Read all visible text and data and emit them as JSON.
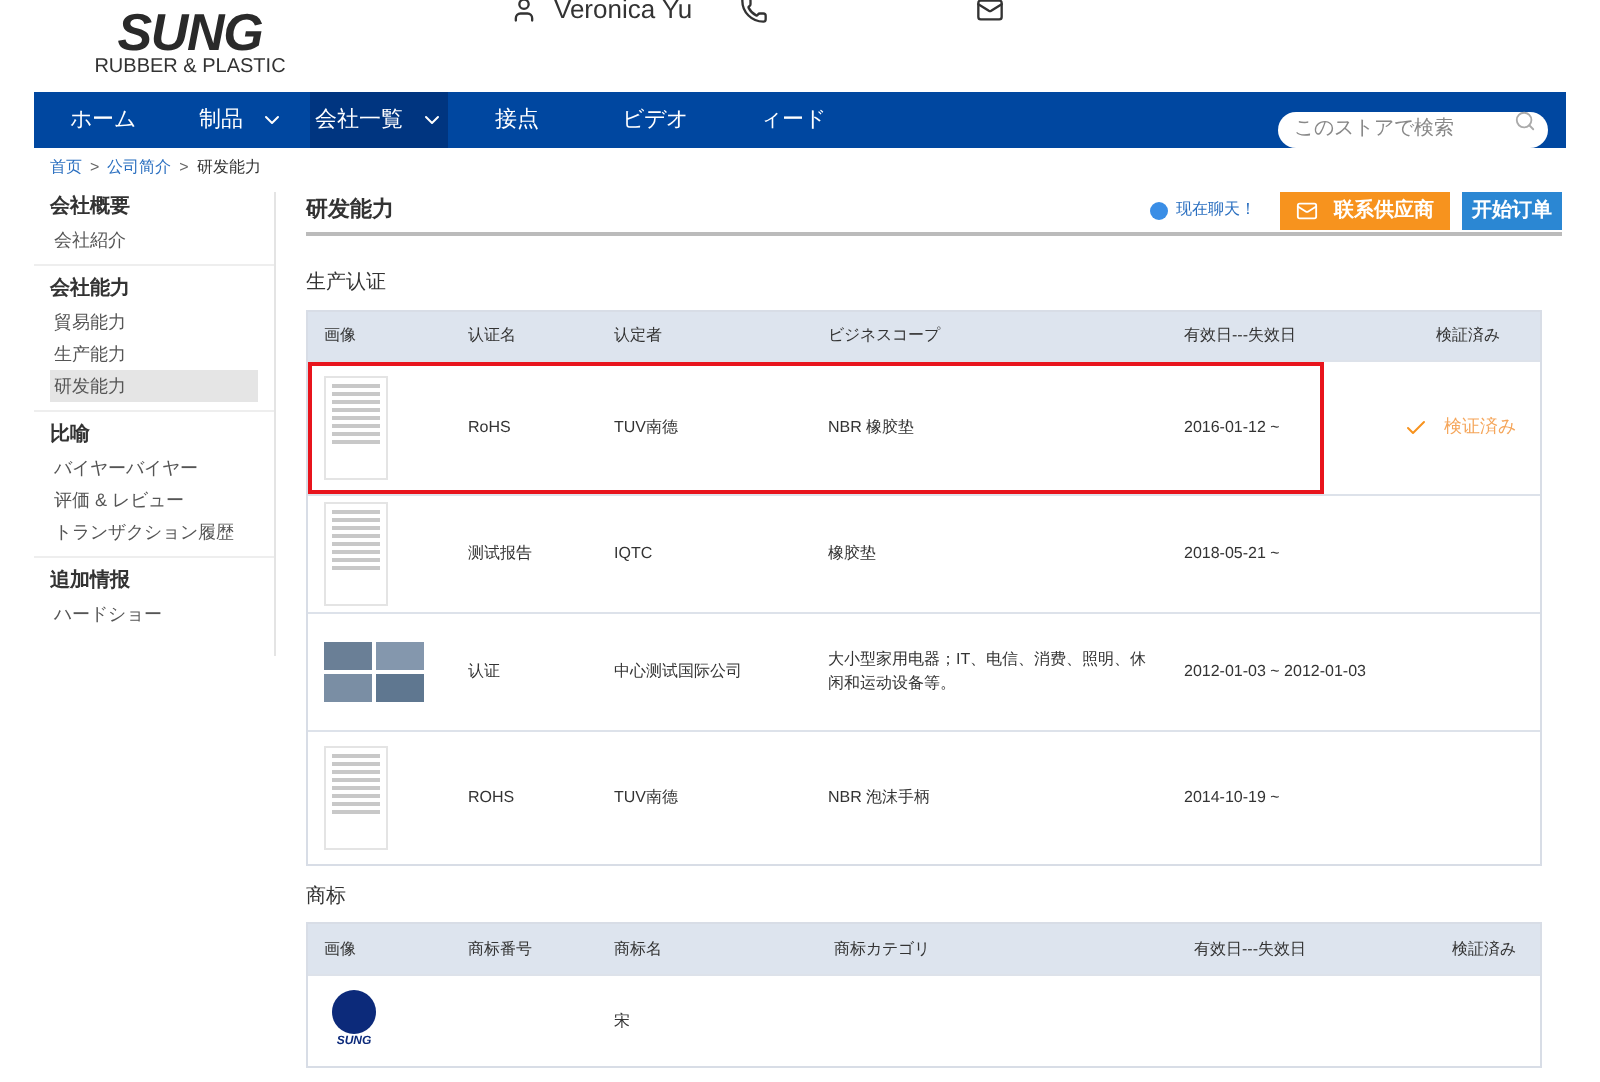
{
  "header": {
    "logo": {
      "name": "SUNG",
      "tagline": "RUBBER & PLASTIC"
    },
    "contact": {
      "name": "Veronica Yu"
    }
  },
  "nav": {
    "items": [
      {
        "label": "ホーム",
        "dropdown": false,
        "selected": false
      },
      {
        "label": "制品",
        "dropdown": true,
        "selected": false
      },
      {
        "label": "会社一覧",
        "dropdown": true,
        "selected": true
      },
      {
        "label": "接点",
        "dropdown": false,
        "selected": false
      },
      {
        "label": "ビデオ",
        "dropdown": false,
        "selected": false
      },
      {
        "label": "ィード",
        "dropdown": false,
        "selected": false
      }
    ],
    "search": {
      "placeholder": "このストアで検索"
    }
  },
  "breadcrumb": {
    "separator": ">",
    "items": [
      "首页",
      "公司简介",
      "研发能力"
    ]
  },
  "sidebar": [
    {
      "title": "会社概要",
      "items": [
        {
          "label": "会社紹介",
          "selected": false
        }
      ]
    },
    {
      "title": "会社能力",
      "items": [
        {
          "label": "貿易能力",
          "selected": false
        },
        {
          "label": "生产能力",
          "selected": false
        },
        {
          "label": "研发能力",
          "selected": true
        }
      ]
    },
    {
      "title": "比喻",
      "items": [
        {
          "label": "バイヤーバイヤー",
          "selected": false
        },
        {
          "label": "评価 & レビュー",
          "selected": false
        },
        {
          "label": "トランザクション履歴",
          "selected": false
        }
      ]
    },
    {
      "title": "追加情报",
      "items": [
        {
          "label": "ハードショー",
          "selected": false
        }
      ]
    }
  ],
  "page": {
    "title": "研发能力",
    "chat": "现在聊天！",
    "contact_button": "联系供应商",
    "order_button": "开始订单"
  },
  "certifications": {
    "label": "生产认证",
    "columns": [
      "画像",
      "认证名",
      "认定者",
      "ビジネスコープ",
      "有效日---失效日",
      "検証済み"
    ],
    "rows": [
      {
        "kind": "document",
        "name": "RoHS",
        "issuer": "TUV南德",
        "scope": "NBR 橡胶垫",
        "dates": "2016-01-12 ~",
        "verified": true,
        "verified_label": "検证済み",
        "highlighted": true
      },
      {
        "kind": "document",
        "name": "测试报告",
        "issuer": "IQTC",
        "scope": "橡胶垫",
        "dates": "2018-05-21 ~",
        "verified": false,
        "highlighted": false
      },
      {
        "kind": "photos",
        "name": "认证",
        "issuer": "中心测试国际公司",
        "scope": "大小型家用电器；IT、电信、消费、照明、休闲和运动设备等。",
        "dates": "2012-01-03 ~ 2012-01-03",
        "verified": false,
        "highlighted": false
      },
      {
        "kind": "document",
        "name": "ROHS",
        "issuer": "TUV南德",
        "scope": "NBR 泡沫手柄",
        "dates": "2014-10-19 ~",
        "verified": false,
        "highlighted": false
      }
    ]
  },
  "trademarks": {
    "label": "商标",
    "columns": [
      "画像",
      "商标番号",
      "商标名",
      "商标カテゴリ",
      "有效日---失效日",
      "検証済み"
    ],
    "rows": [
      {
        "logo_text": "SUNG",
        "name": "宋"
      }
    ]
  }
}
